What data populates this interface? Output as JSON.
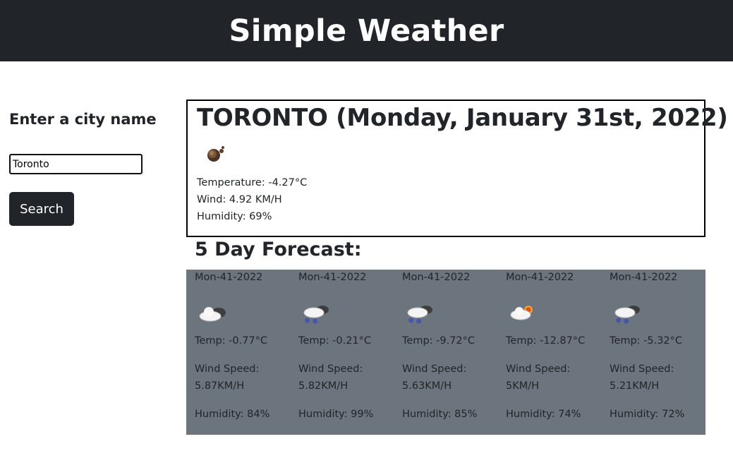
{
  "header": {
    "title": "Simple Weather"
  },
  "search": {
    "label": "Enter a city name",
    "input_value": "Toronto",
    "button_label": "Search"
  },
  "current": {
    "title": "TORONTO (Monday, January 31st, 2022)",
    "icon": "night-cloud-icon",
    "temperature": "Temperature: -4.27°C",
    "wind": "Wind: 4.92 KM/H",
    "humidity": "Humidity: 69%"
  },
  "forecast": {
    "title": "5 Day Forecast:",
    "days": [
      {
        "date": "Mon-41-2022",
        "icon": "cloudy-icon",
        "temp": "Temp: -0.77°C",
        "wind_label": "Wind Speed:",
        "wind_value": "5.87KM/H",
        "humidity": "Humidity: 84%"
      },
      {
        "date": "Mon-41-2022",
        "icon": "snow-icon",
        "temp": "Temp: -0.21°C",
        "wind_label": "Wind Speed:",
        "wind_value": "5.82KM/H",
        "humidity": "Humidity: 99%"
      },
      {
        "date": "Mon-41-2022",
        "icon": "snow-icon",
        "temp": "Temp: -9.72°C",
        "wind_label": "Wind Speed:",
        "wind_value": "5.63KM/H",
        "humidity": "Humidity: 85%"
      },
      {
        "date": "Mon-41-2022",
        "icon": "partly-sunny-icon",
        "temp": "Temp: -12.87°C",
        "wind_label": "Wind Speed:",
        "wind_value": "5KM/H",
        "humidity": "Humidity: 74%"
      },
      {
        "date": "Mon-41-2022",
        "icon": "snow-icon",
        "temp": "Temp: -5.32°C",
        "wind_label": "Wind Speed:",
        "wind_value": "5.21KM/H",
        "humidity": "Humidity: 72%"
      }
    ]
  },
  "colors": {
    "header_bg": "#212529",
    "forecast_bg": "#6c757d",
    "button_bg": "#212529"
  }
}
